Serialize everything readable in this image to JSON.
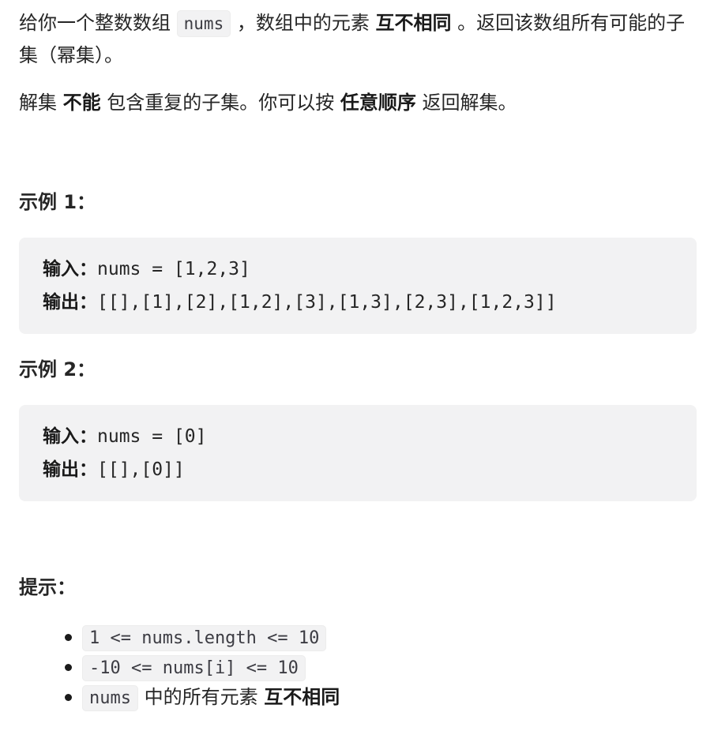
{
  "description": {
    "p1_part1": "给你一个整数数组 ",
    "p1_code": "nums",
    "p1_part2": " ，数组中的元素 ",
    "p1_bold": "互不相同",
    "p1_part3": " 。返回该数组所有可能的子集（幂集）。",
    "p2_part1": "解集 ",
    "p2_bold1": "不能",
    "p2_part2": " 包含重复的子集。你可以按 ",
    "p2_bold2": "任意顺序",
    "p2_part3": " 返回解集。"
  },
  "examples": [
    {
      "heading": "示例 1：",
      "input_label": "输入：",
      "input_value": "nums = [1,2,3]",
      "output_label": "输出：",
      "output_value": "[[],[1],[2],[1,2],[3],[1,3],[2,3],[1,2,3]]"
    },
    {
      "heading": "示例 2：",
      "input_label": "输入：",
      "input_value": "nums = [0]",
      "output_label": "输出：",
      "output_value": "[[],[0]]"
    }
  ],
  "hints": {
    "heading": "提示：",
    "items": [
      {
        "code": "1 <= nums.length <= 10"
      },
      {
        "code": "-10 <= nums[i] <= 10"
      },
      {
        "code": "nums",
        "text": " 中的所有元素 ",
        "bold": "互不相同"
      }
    ]
  }
}
